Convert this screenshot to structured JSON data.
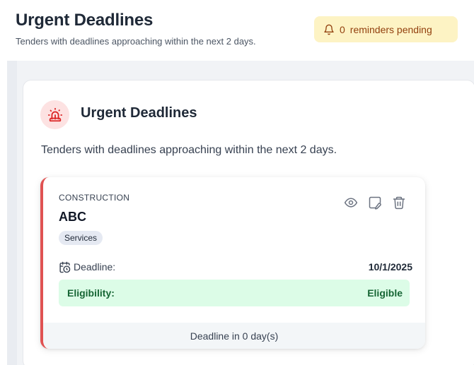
{
  "header": {
    "title": "Urgent Deadlines",
    "subtitle": "Tenders with deadlines approaching within the next 2 days.",
    "reminder_count": "0",
    "reminder_label": "reminders pending"
  },
  "panel": {
    "icon": "siren-icon",
    "title": "Urgent Deadlines",
    "subtitle": "Tenders with deadlines approaching within the next 2 days."
  },
  "tender_card": {
    "category": "CONSTRUCTION",
    "name": "ABC",
    "tag": "Services",
    "actions": [
      "view-icon",
      "edit-icon",
      "delete-icon"
    ],
    "deadline_label": "Deadline:",
    "deadline_value": "10/1/2025",
    "eligibility_label": "Eligibility:",
    "eligibility_value": "Eligible",
    "footer": "Deadline in 0 day(s)"
  },
  "colors": {
    "accent_red": "#e05252",
    "badge_bg": "#fdf3c4",
    "eligible_bg": "#dcfce7",
    "eligible_text": "#166534"
  }
}
